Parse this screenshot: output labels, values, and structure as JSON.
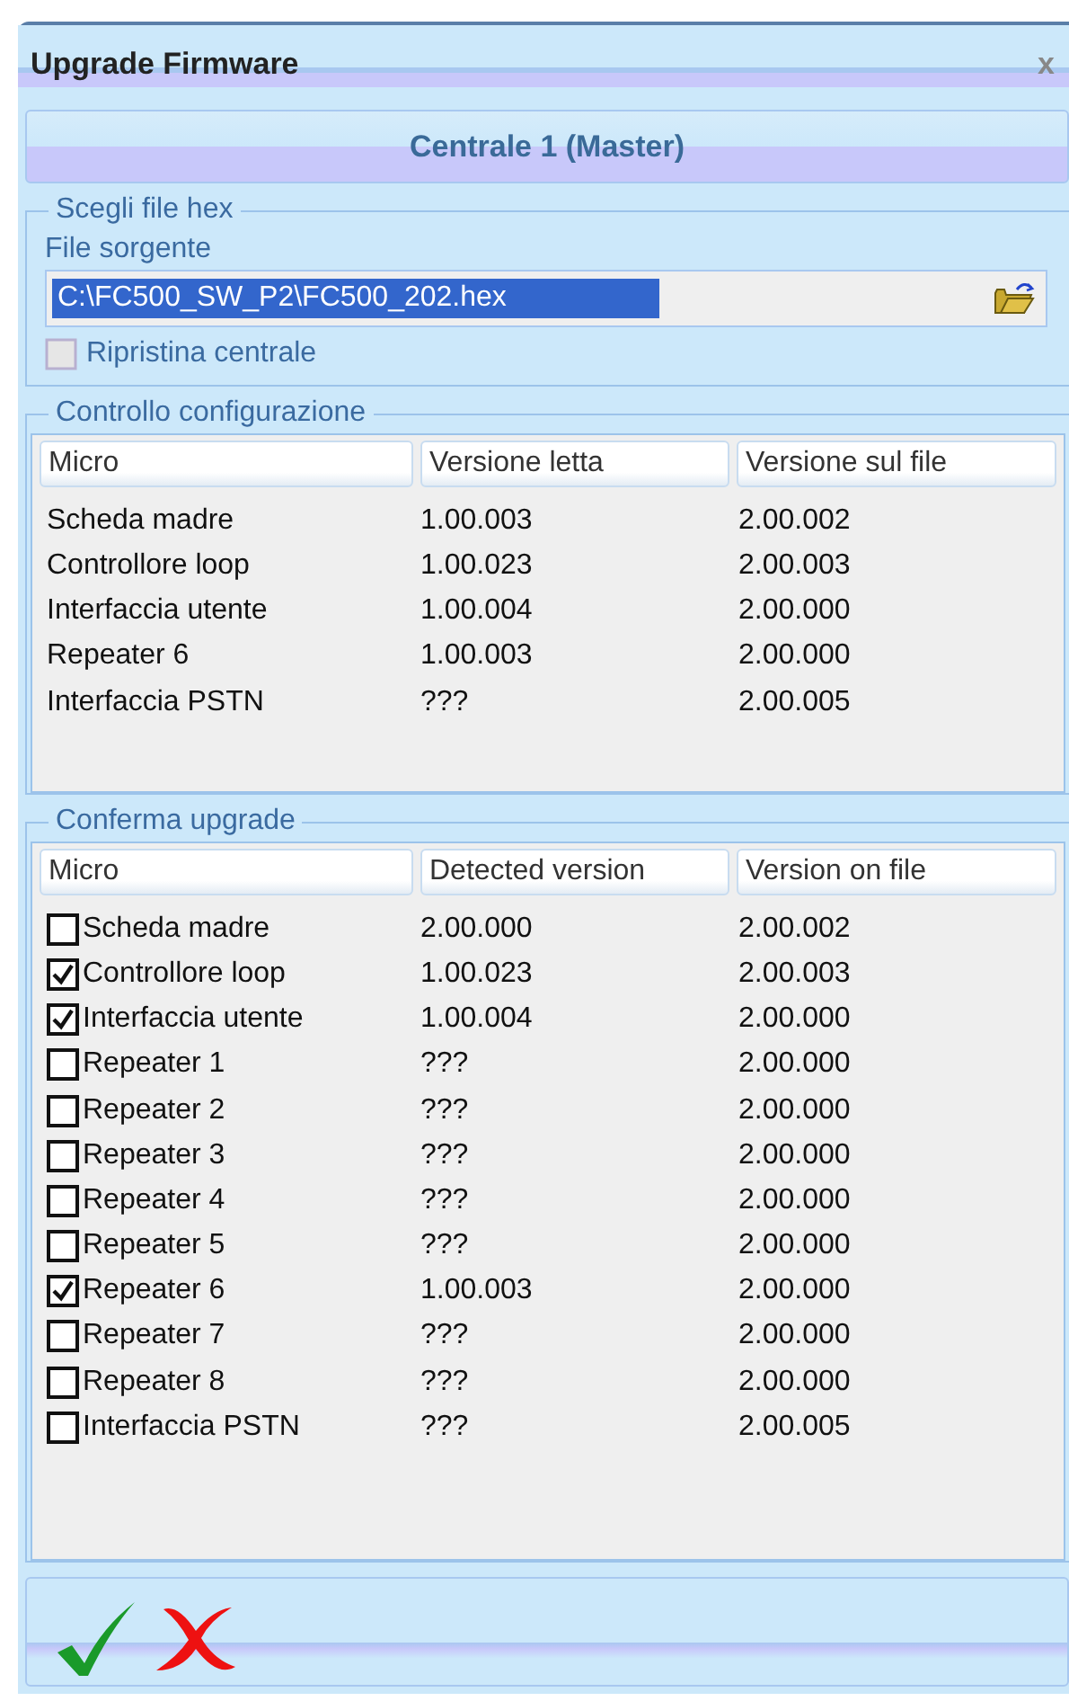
{
  "window": {
    "title": "Upgrade Firmware",
    "close": "x"
  },
  "header": "Centrale 1 (Master)",
  "file_group": {
    "legend": "Scegli file hex",
    "field_label": "File sorgente",
    "value": "C:\\FC500_SW_P2\\FC500_202.hex",
    "restore": {
      "label": "Ripristina centrale",
      "checked": false,
      "disabled": true
    }
  },
  "groups": [
    {
      "legend": "Controllo configurazione",
      "kind": "plain",
      "columns": [
        "Micro",
        "Versione letta",
        "Versione sul file"
      ],
      "rows": [
        {
          "cells": [
            "Scheda madre",
            "1.00.003",
            "2.00.002"
          ]
        },
        {
          "cells": [
            "Controllore loop",
            "1.00.023",
            "2.00.003"
          ]
        },
        {
          "cells": [
            "Interfaccia utente",
            "1.00.004",
            "2.00.000"
          ]
        },
        {
          "cells": [
            "Repeater 6",
            "1.00.003",
            "2.00.000"
          ]
        },
        {
          "cells": [
            "Interfaccia PSTN",
            "???",
            "2.00.005"
          ]
        }
      ]
    },
    {
      "legend": "Conferma upgrade",
      "kind": "checklist",
      "columns": [
        "Micro",
        "Detected version",
        "Version on file"
      ],
      "rows": [
        {
          "checked": false,
          "cells": [
            "Scheda madre",
            "2.00.000",
            "2.00.002"
          ]
        },
        {
          "checked": true,
          "cells": [
            "Controllore loop",
            "1.00.023",
            "2.00.003"
          ]
        },
        {
          "checked": true,
          "cells": [
            "Interfaccia utente",
            "1.00.004",
            "2.00.000"
          ]
        },
        {
          "checked": false,
          "cells": [
            "Repeater 1",
            "???",
            "2.00.000"
          ]
        },
        {
          "checked": false,
          "cells": [
            "Repeater 2",
            "???",
            "2.00.000"
          ]
        },
        {
          "checked": false,
          "cells": [
            "Repeater 3",
            "???",
            "2.00.000"
          ]
        },
        {
          "checked": false,
          "cells": [
            "Repeater 4",
            "???",
            "2.00.000"
          ]
        },
        {
          "checked": false,
          "cells": [
            "Repeater 5",
            "???",
            "2.00.000"
          ]
        },
        {
          "checked": true,
          "cells": [
            "Repeater 6",
            "1.00.003",
            "2.00.000"
          ]
        },
        {
          "checked": false,
          "cells": [
            "Repeater 7",
            "???",
            "2.00.000"
          ]
        },
        {
          "checked": false,
          "cells": [
            "Repeater 8",
            "???",
            "2.00.000"
          ]
        },
        {
          "checked": false,
          "cells": [
            "Interfaccia PSTN",
            "???",
            "2.00.005"
          ]
        }
      ]
    }
  ]
}
